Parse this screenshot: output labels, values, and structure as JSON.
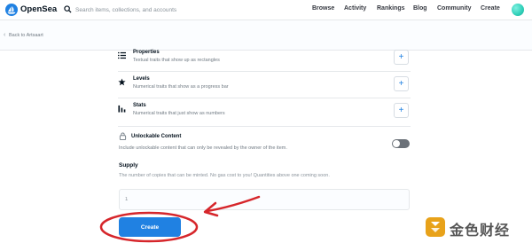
{
  "header": {
    "brand": "OpenSea",
    "search_placeholder": "Search items, collections, and accounts",
    "nav": [
      "Browse",
      "Activity",
      "Rankings",
      "Blog",
      "Community",
      "Create"
    ]
  },
  "backbar": {
    "label": "Back to Artsaart"
  },
  "traits": [
    {
      "title": "Properties",
      "description": "Textual traits that show up as rectangles",
      "icon": "list-icon"
    },
    {
      "title": "Levels",
      "description": "Numerical traits that show as a progress bar",
      "icon": "star-icon"
    },
    {
      "title": "Stats",
      "description": "Numerical traits that just show as numbers",
      "icon": "bar-chart-icon"
    }
  ],
  "unlockable": {
    "title": "Unlockable Content",
    "description": "Include unlockable content that can only be revealed by the owner of the item.",
    "enabled": false
  },
  "supply": {
    "label": "Supply",
    "description": "The number of copies that can be minted. No gas cost to you! Quantities above one coming soon.",
    "value": "1"
  },
  "create_button": "Create",
  "watermark": {
    "text": "金色财经"
  },
  "colors": {
    "accent": "#2081e2",
    "annotation": "#d6262b"
  }
}
